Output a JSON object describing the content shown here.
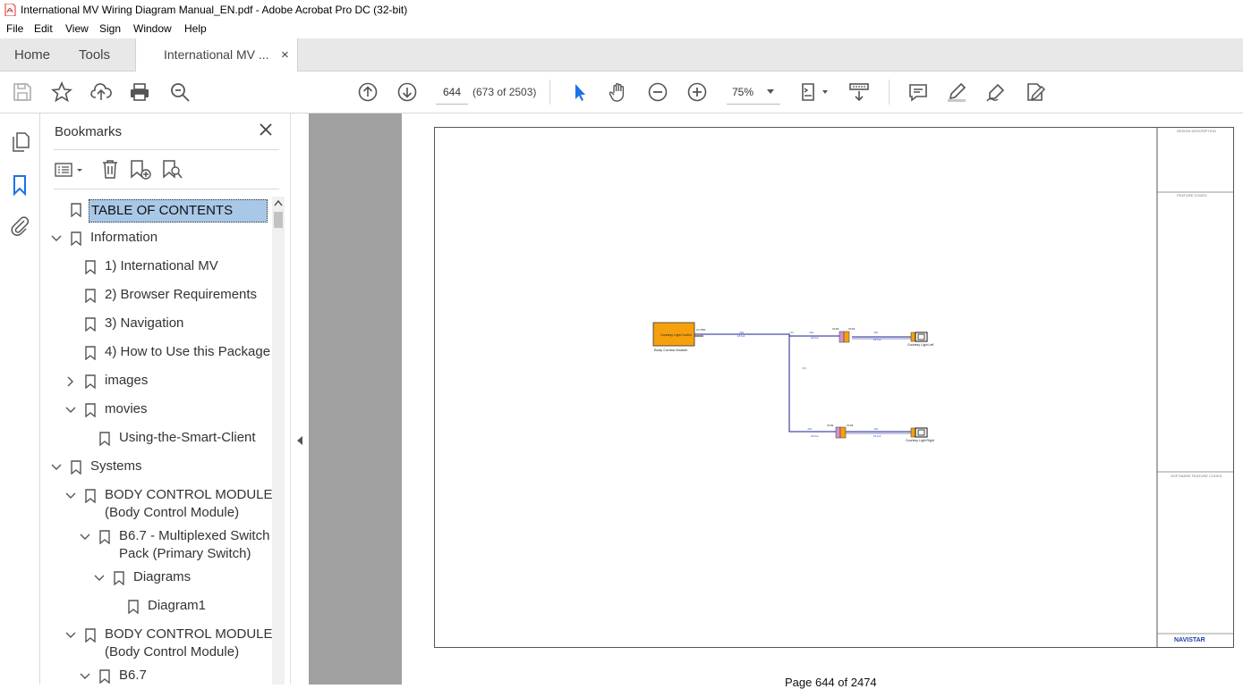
{
  "window": {
    "title": "International MV Wiring Diagram Manual_EN.pdf - Adobe Acrobat Pro DC (32-bit)"
  },
  "menu": [
    "File",
    "Edit",
    "View",
    "Sign",
    "Window",
    "Help"
  ],
  "tabs": {
    "home": "Home",
    "tools": "Tools",
    "document": "International MV ...",
    "close": "×"
  },
  "toolbar": {
    "page_input": "644",
    "page_count": "(673 of 2503)",
    "zoom": "75%"
  },
  "bookmarks": {
    "title": "Bookmarks",
    "items": [
      {
        "label": "TABLE OF CONTENTS",
        "selected": true
      },
      {
        "label": "Information"
      },
      {
        "label": "1) International MV"
      },
      {
        "label": "2) Browser Requirements"
      },
      {
        "label": "3) Navigation"
      },
      {
        "label": "4) How to Use this Package"
      },
      {
        "label": "images"
      },
      {
        "label": "movies"
      },
      {
        "label": "Using-the-Smart-Client"
      },
      {
        "label": "Systems"
      },
      {
        "label": "BODY CONTROL MODULE",
        "label2": "(Body Control Module)"
      },
      {
        "label": "B6.7 - Multiplexed Switch",
        "label2": "Pack (Primary Switch)"
      },
      {
        "label": "Diagrams"
      },
      {
        "label": "Diagram1"
      },
      {
        "label": "BODY CONTROL MODULE",
        "label2": "(Body Control Module)"
      },
      {
        "label": "B6.7"
      }
    ]
  },
  "diagram": {
    "module_label": "Courtesy Light Control",
    "module_caption": "Body Control Module",
    "lamp_left": "Courtesy Light Left",
    "lamp_right": "Courtesy Light Right",
    "panel_design": "DESIGN DESCRIPTION",
    "panel_feature": "FEATURE CODES",
    "panel_software": "SOFTWARE FEATURE CODES",
    "brand": "NAVISTAR"
  },
  "footer": {
    "page_label": "Page 644 of 2474"
  }
}
